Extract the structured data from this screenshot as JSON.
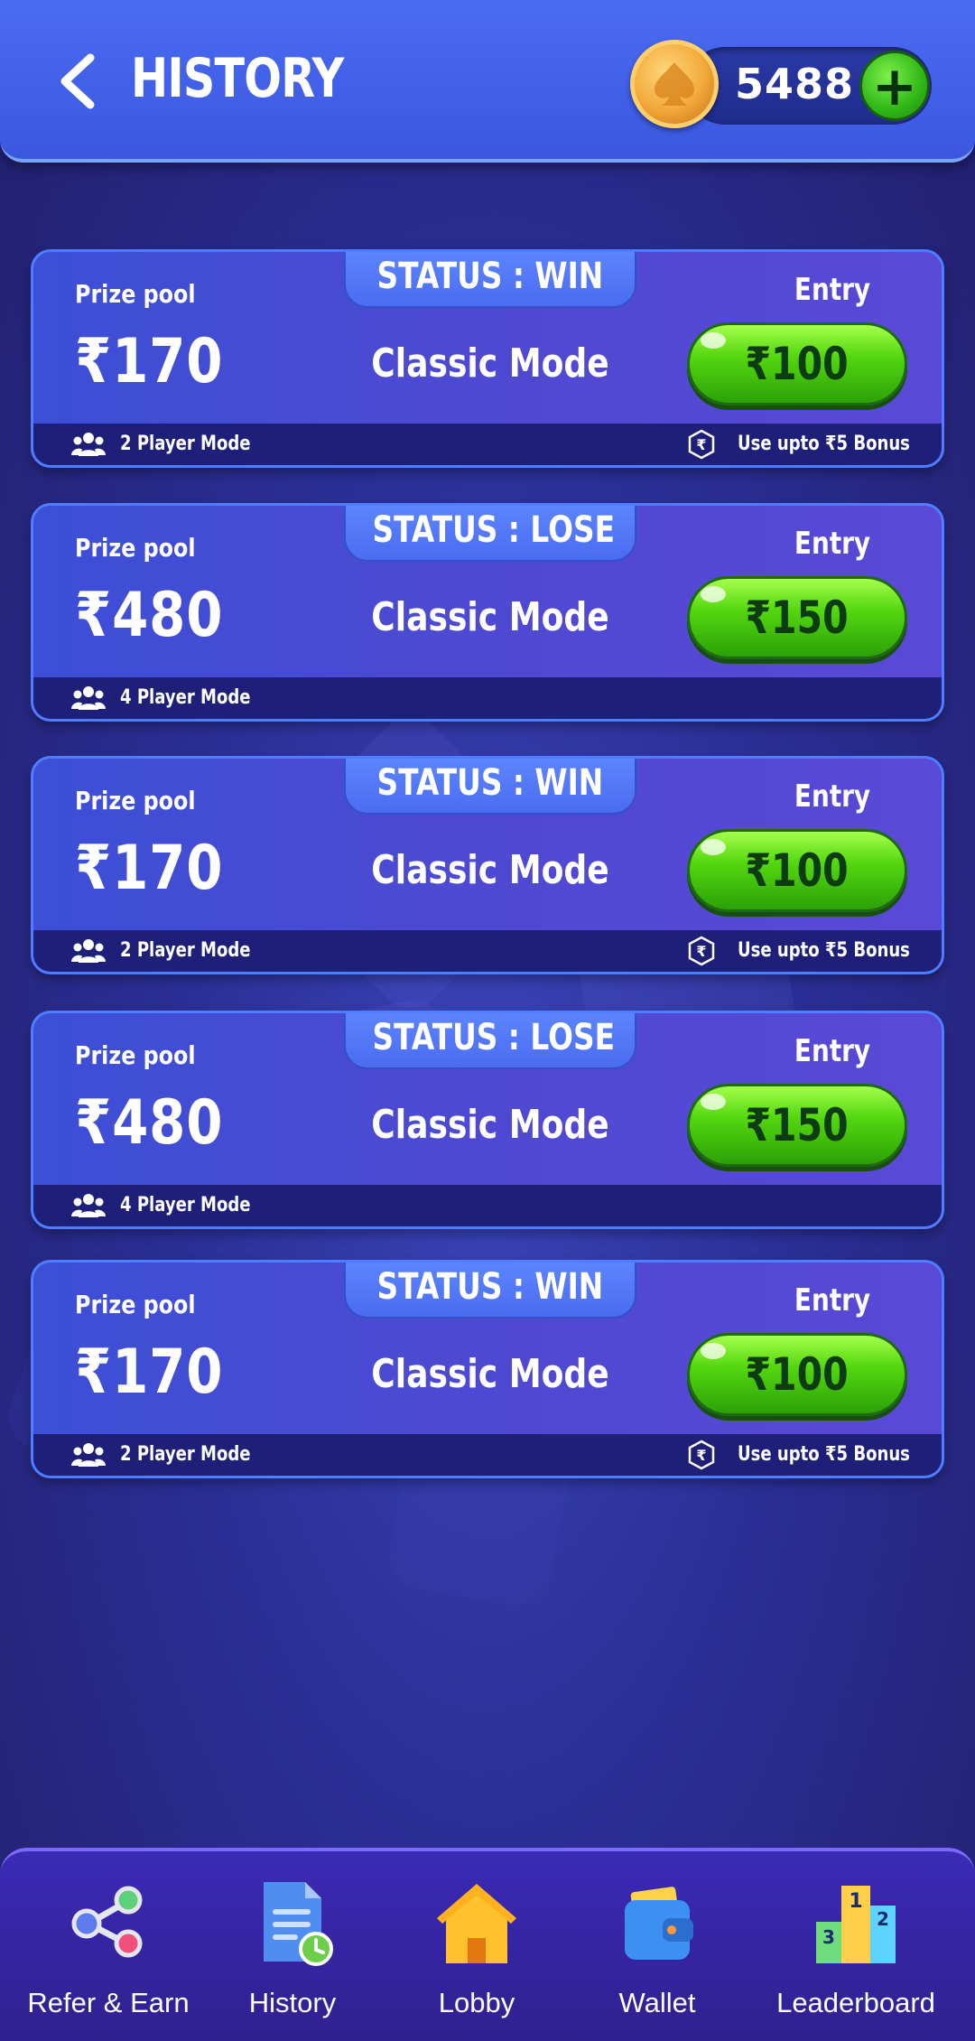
{
  "header": {
    "title": "HISTORY",
    "balance": "5488",
    "add_label": "+"
  },
  "cards": [
    {
      "status": "STATUS : WIN",
      "prize_label": "Prize pool",
      "prize_amount": "₹170",
      "mode": "Classic Mode",
      "entry_label": "Entry",
      "entry_fee": "₹100",
      "player_mode": "2 Player Mode",
      "bonus": "Use upto ₹5 Bonus"
    },
    {
      "status": "STATUS : LOSE",
      "prize_label": "Prize pool",
      "prize_amount": "₹480",
      "mode": "Classic Mode",
      "entry_label": "Entry",
      "entry_fee": "₹150",
      "player_mode": "4 Player Mode",
      "bonus": ""
    },
    {
      "status": "STATUS : WIN",
      "prize_label": "Prize pool",
      "prize_amount": "₹170",
      "mode": "Classic Mode",
      "entry_label": "Entry",
      "entry_fee": "₹100",
      "player_mode": "2 Player Mode",
      "bonus": "Use upto ₹5 Bonus"
    },
    {
      "status": "STATUS : LOSE",
      "prize_label": "Prize pool",
      "prize_amount": "₹480",
      "mode": "Classic Mode",
      "entry_label": "Entry",
      "entry_fee": "₹150",
      "player_mode": "4 Player Mode",
      "bonus": ""
    },
    {
      "status": "STATUS : WIN",
      "prize_label": "Prize pool",
      "prize_amount": "₹170",
      "mode": "Classic Mode",
      "entry_label": "Entry",
      "entry_fee": "₹100",
      "player_mode": "2 Player Mode",
      "bonus": "Use upto ₹5 Bonus"
    }
  ],
  "nav": {
    "items": [
      {
        "label": "Refer & Earn",
        "icon": "share-icon"
      },
      {
        "label": "History",
        "icon": "history-icon"
      },
      {
        "label": "Lobby",
        "icon": "home-icon"
      },
      {
        "label": "Wallet",
        "icon": "wallet-icon"
      },
      {
        "label": "Leaderboard",
        "icon": "podium-icon"
      }
    ]
  },
  "colors": {
    "header": "#3b57e0",
    "card": "#4a4fd4",
    "entry_button": "#4fc812",
    "nav": "#33239a"
  }
}
